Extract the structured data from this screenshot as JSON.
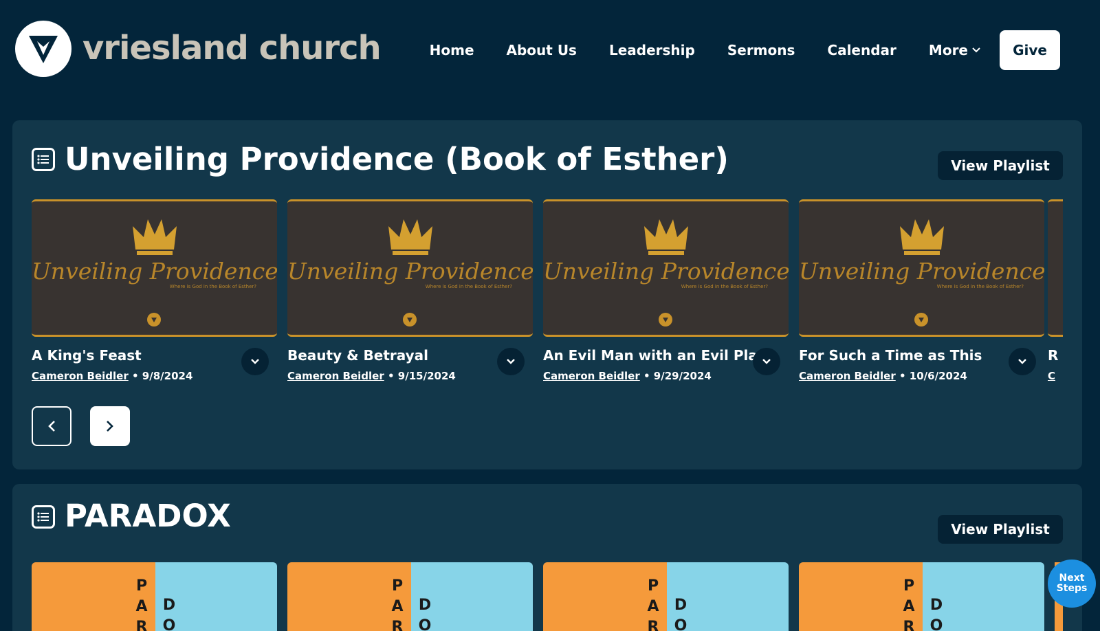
{
  "site": {
    "name": "vriesland church"
  },
  "nav": {
    "items": [
      "Home",
      "About Us",
      "Leadership",
      "Sermons",
      "Calendar",
      "More"
    ],
    "give_label": "Give"
  },
  "playlists": [
    {
      "title": "Unveiling Providence (Book of Esther)",
      "view_label": "View Playlist",
      "thumbnail": {
        "brand": "Unveiling Providence",
        "tagline": "Where is God in the Book of Esther?"
      },
      "sermons": [
        {
          "title": "A King's Feast",
          "speaker": "Cameron Beidler",
          "date": "9/8/2024"
        },
        {
          "title": "Beauty & Betrayal",
          "speaker": "Cameron Beidler",
          "date": "9/15/2024"
        },
        {
          "title": "An Evil Man with an Evil Plan",
          "speaker": "Cameron Beidler",
          "date": "9/29/2024"
        },
        {
          "title": "For Such a Time as This",
          "speaker": "Cameron Beidler",
          "date": "10/6/2024"
        }
      ],
      "peek": {
        "title": "R",
        "speaker": "C"
      }
    },
    {
      "title": "PARADOX",
      "view_label": "View Playlist",
      "thumbnail": {
        "left": "PAR",
        "right": "DO"
      }
    }
  ],
  "floating": {
    "next_steps": "Next Steps"
  },
  "colors": {
    "background": "#03253a",
    "panel": "#12374a",
    "gold": "#c9922a",
    "orange": "#f59a3b",
    "light_blue": "#87d4e8",
    "cta_blue": "#1c8fe0"
  }
}
